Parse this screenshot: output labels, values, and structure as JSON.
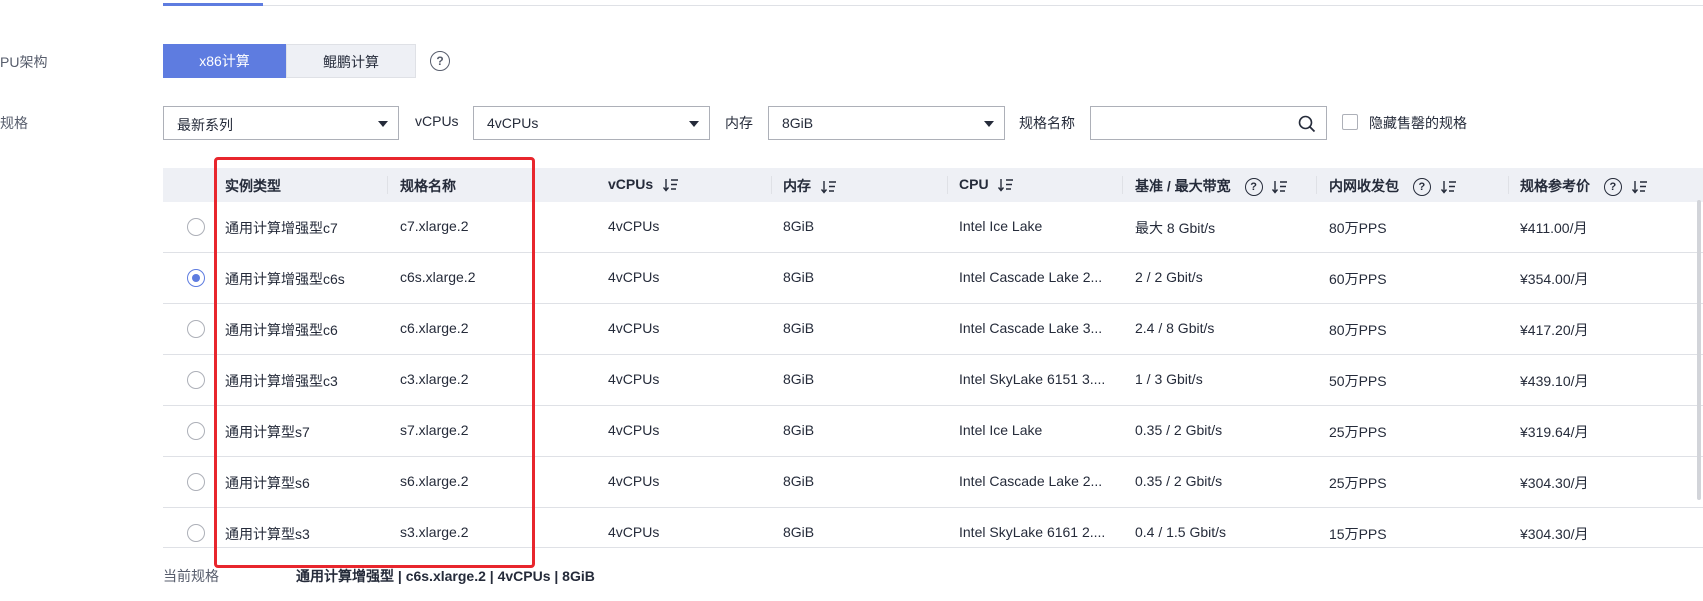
{
  "cpu_arch": {
    "label": "PU架构",
    "options": [
      "x86计算",
      "鲲鹏计算"
    ],
    "selected": "x86计算"
  },
  "spec_filter": {
    "label": "规格",
    "series_value": "最新系列",
    "vcpus_label": "vCPUs",
    "vcpus_value": "4vCPUs",
    "memory_label": "内存",
    "memory_value": "8GiB",
    "name_label": "规格名称",
    "name_placeholder": "",
    "hide_soldout_label": "隐藏售罄的规格",
    "hide_soldout_checked": false
  },
  "table": {
    "headers": [
      "实例类型",
      "规格名称",
      "vCPUs",
      "内存",
      "CPU",
      "基准 / 最大带宽",
      "内网收发包",
      "规格参考价"
    ],
    "rows": [
      {
        "type": "通用计算增强型c7",
        "name": "c7.xlarge.2",
        "vcpus": "4vCPUs",
        "memory": "8GiB",
        "cpu": "Intel Ice Lake",
        "bandwidth": "最大 8 Gbit/s",
        "pps": "80万PPS",
        "price": "¥411.00/月",
        "selected": false
      },
      {
        "type": "通用计算增强型c6s",
        "name": "c6s.xlarge.2",
        "vcpus": "4vCPUs",
        "memory": "8GiB",
        "cpu": "Intel Cascade Lake 2...",
        "bandwidth": "2 / 2 Gbit/s",
        "pps": "60万PPS",
        "price": "¥354.00/月",
        "selected": true
      },
      {
        "type": "通用计算增强型c6",
        "name": "c6.xlarge.2",
        "vcpus": "4vCPUs",
        "memory": "8GiB",
        "cpu": "Intel Cascade Lake 3...",
        "bandwidth": "2.4 / 8 Gbit/s",
        "pps": "80万PPS",
        "price": "¥417.20/月",
        "selected": false
      },
      {
        "type": "通用计算增强型c3",
        "name": "c3.xlarge.2",
        "vcpus": "4vCPUs",
        "memory": "8GiB",
        "cpu": "Intel SkyLake 6151 3....",
        "bandwidth": "1 / 3 Gbit/s",
        "pps": "50万PPS",
        "price": "¥439.10/月",
        "selected": false
      },
      {
        "type": "通用计算型s7",
        "name": "s7.xlarge.2",
        "vcpus": "4vCPUs",
        "memory": "8GiB",
        "cpu": "Intel Ice Lake",
        "bandwidth": "0.35 / 2 Gbit/s",
        "pps": "25万PPS",
        "price": "¥319.64/月",
        "selected": false
      },
      {
        "type": "通用计算型s6",
        "name": "s6.xlarge.2",
        "vcpus": "4vCPUs",
        "memory": "8GiB",
        "cpu": "Intel Cascade Lake 2...",
        "bandwidth": "0.35 / 2 Gbit/s",
        "pps": "25万PPS",
        "price": "¥304.30/月",
        "selected": false
      },
      {
        "type": "通用计算型s3",
        "name": "s3.xlarge.2",
        "vcpus": "4vCPUs",
        "memory": "8GiB",
        "cpu": "Intel SkyLake 6161 2....",
        "bandwidth": "0.4 / 1.5 Gbit/s",
        "pps": "15万PPS",
        "price": "¥304.30/月",
        "selected": false
      }
    ]
  },
  "current_spec": {
    "label": "当前规格",
    "value": "通用计算增强型 | c6s.xlarge.2 | 4vCPUs | 8GiB"
  },
  "colors": {
    "accent": "#5e7ce0",
    "highlight_box": "#e8262d"
  },
  "icons": {
    "help": "question-circle-icon",
    "sort": "sort-icon",
    "search": "search-icon",
    "dropdown": "caret-down-icon"
  }
}
